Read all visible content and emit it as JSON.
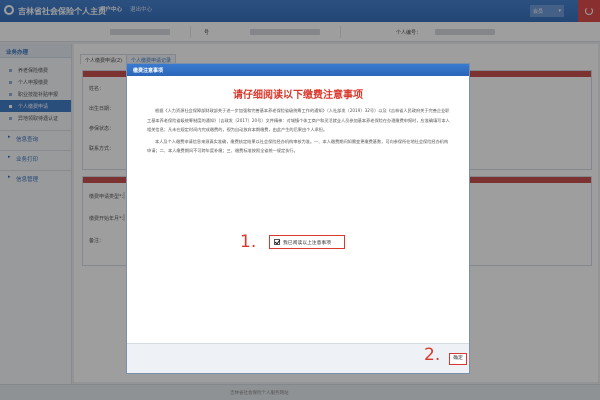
{
  "header": {
    "app_title": "吉林省社会保险个人主页",
    "nav": [
      "用户中心",
      "退出中心"
    ],
    "user_label": "会员"
  },
  "infobar": {
    "id_label": "号",
    "person_code_label": "个人编号："
  },
  "sidebar": {
    "section_title": "业务办理",
    "items": [
      {
        "label": "养老保险缴费"
      },
      {
        "label": "个人申报缴费"
      },
      {
        "label": "职业技能补贴申报"
      },
      {
        "label": "个人缴费申请"
      },
      {
        "label": "异地领取待遇认证"
      }
    ],
    "sections": [
      {
        "label": "信息查询"
      },
      {
        "label": "业务打印"
      },
      {
        "label": "信息管理"
      }
    ]
  },
  "main": {
    "tabs": [
      "个人缴费申请(2)",
      "个人缴费申请记录"
    ],
    "form_labels": [
      "姓名：",
      "出生日期：",
      "参保状态：",
      "联系方式："
    ],
    "form2_labels": [
      "缴费申请类型*：",
      "缴费开始年月*：",
      "备注："
    ]
  },
  "modal": {
    "window_title": "缴费注意事项",
    "title": "请仔细阅读以下缴费注意事项",
    "paragraphs": [
      "根据《人力资源社会保障部财政部关于进一步加强和完善基本养老保险省级统筹工作的通知》（人社部发〔2019〕32号）以及《吉林省人民政府关于完善企业职工基本养老保险省级统筹制度的通知》（吉政发〔2017〕20号）文件精神：对城镇个体工商户和灵活就业人员参加基本养老保险在办理缴费申报时，应准确填写本人相关信息；凡未在规定时间内完成缴费的，视为自动放弃本期缴费，由此产生的后果由个人承担。",
      "本人及个人缴费申请信息来源真实准确，缴费核定结果以社会保险经办机构审核为准。一、本人缴费期间如需变更缴费基数，可向参保所在地社会保险经办机构申请；二、本人缴费期间不可跨年度补缴；三、缴费标准按照全省统一规定执行。"
    ],
    "agree_label": "我已阅读以上注意事项",
    "confirm_label": "确定"
  },
  "annotations": {
    "step1": "1.",
    "step2": "2."
  },
  "footer": {
    "text": "吉林省社会保险个人服务网站"
  }
}
